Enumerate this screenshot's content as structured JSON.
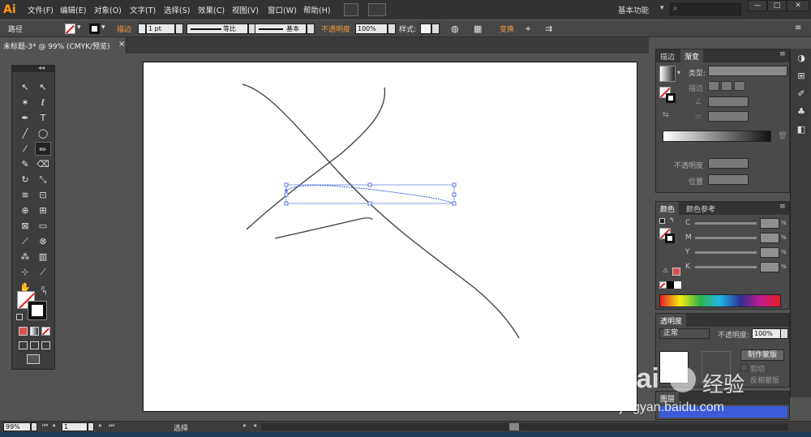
{
  "app": {
    "logo": "Ai",
    "workspace": "基本功能"
  },
  "menu": [
    "文件(F)",
    "编辑(E)",
    "对象(O)",
    "文字(T)",
    "选择(S)",
    "效果(C)",
    "视图(V)",
    "窗口(W)",
    "帮助(H)"
  ],
  "window_buttons": [
    "—",
    "□",
    "✕"
  ],
  "control": {
    "object_type": "路径",
    "stroke_label": "描边",
    "stroke_weight": "1 pt",
    "profile_label": "等比",
    "brush_label": "基本",
    "opacity_label": "不透明度",
    "opacity_value": "100%",
    "style_label": "样式:",
    "transform_label": "变换"
  },
  "document": {
    "tab_title": "未标题-3* @ 99% (CMYK/预览)",
    "close_icon": "×"
  },
  "gradient_panel": {
    "tabs": [
      "描边",
      "渐变"
    ],
    "type_label": "类型:",
    "stroke_label": "描边",
    "opacity_label": "不透明度",
    "position_label": "位置"
  },
  "color_panel": {
    "tabs": [
      "颜色",
      "颜色参考"
    ],
    "channels": [
      "C",
      "M",
      "Y",
      "K"
    ],
    "percent": "%"
  },
  "transparency_panel": {
    "tab": "透明度",
    "mode": "正常",
    "opacity_label": "不透明度:",
    "opacity_value": "100%",
    "mask_button": "制作蒙版",
    "clip_label": "剪切",
    "invert_label": "反相蒙版"
  },
  "layers_panel": {
    "tab": "图层"
  },
  "status": {
    "zoom": "99%",
    "artboard": "1",
    "tool_name": "选择"
  },
  "watermark": {
    "brand": "Bai",
    "brand2": "经验",
    "url": "jingyan.baidu.com"
  },
  "colors": {
    "accent_orange": "#f29a3a",
    "selection_blue": "#3b5bd9",
    "path_stroke": "#3a3a3a",
    "fill_swatch": "#d9534f"
  }
}
